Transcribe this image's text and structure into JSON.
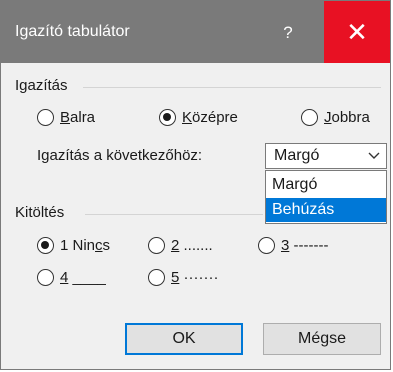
{
  "window": {
    "title": "Igazító tabulátor",
    "help_label": "?",
    "close_label": "✕"
  },
  "alignment": {
    "group_label": "Igazítás",
    "options": [
      {
        "label_accel": "B",
        "label_rest": "alra",
        "checked": false
      },
      {
        "label_accel": "K",
        "label_rest": "özépre",
        "checked": true
      },
      {
        "label_accel": "J",
        "label_rest": "obbra",
        "checked": false
      }
    ],
    "relative_to_label": "Igazítás a következőhöz:",
    "relative_to_value": "Margó",
    "dropdown_options": [
      "Margó",
      "Behúzás"
    ],
    "dropdown_highlighted": "Behúzás"
  },
  "fill": {
    "group_label": "Kitöltés",
    "options": [
      {
        "label_prefix": "1 Nin",
        "label_accel": "c",
        "label_rest": "s",
        "checked": true
      },
      {
        "label_prefix": "",
        "label_accel": "2",
        "label_rest": " .......",
        "checked": false
      },
      {
        "label_prefix": "",
        "label_accel": "3",
        "label_rest": " -------",
        "checked": false
      },
      {
        "label_prefix": "",
        "label_accel": "4",
        "label_rest": " ____",
        "checked": false
      },
      {
        "label_prefix": "",
        "label_accel": "5",
        "label_rest": " ·······",
        "checked": false
      }
    ]
  },
  "buttons": {
    "ok_label": "OK",
    "cancel_label": "Mégse"
  },
  "colors": {
    "titlebar": "#7a7a7a",
    "close_hover": "#e81123",
    "selection": "#0078d7"
  }
}
